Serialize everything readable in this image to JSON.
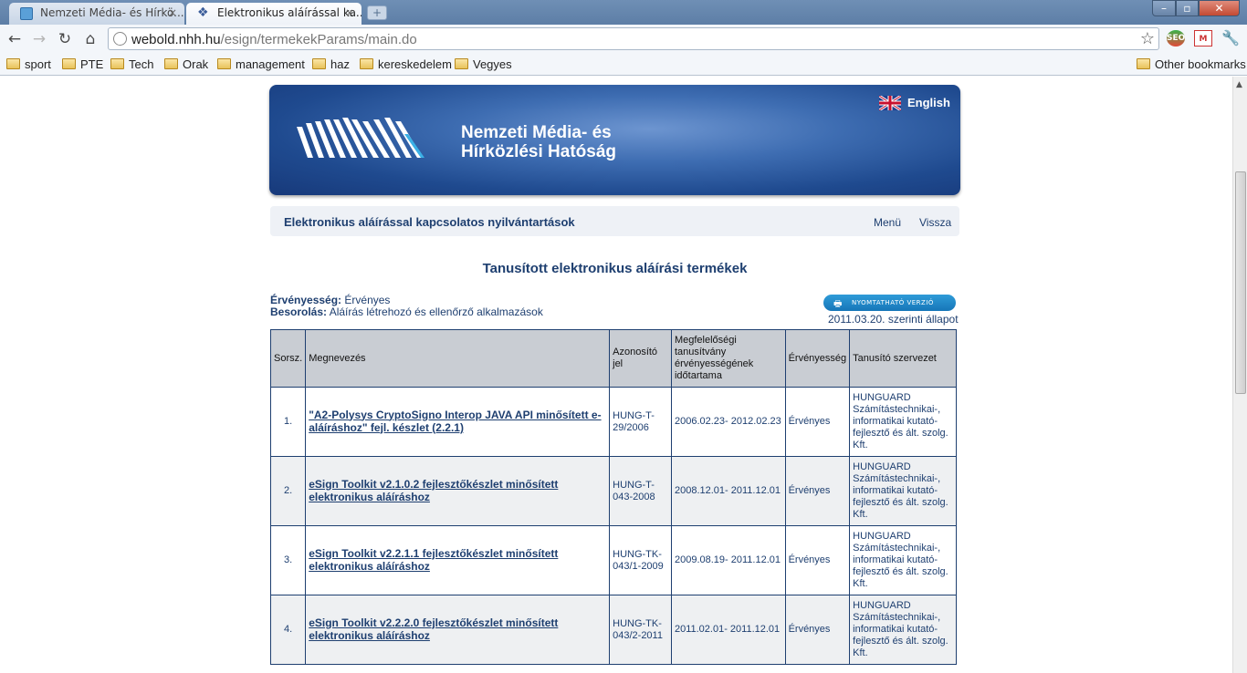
{
  "browser": {
    "tabs": [
      {
        "title": "Nemzeti Média- és Hírkö...",
        "active": false
      },
      {
        "title": "Elektronikus aláírással ka...",
        "active": true
      }
    ],
    "url_domain": "webold.nhh.hu",
    "url_path": "/esign/termekekParams/main.do",
    "bookmarks": [
      "sport",
      "PTE",
      "Tech",
      "Orak",
      "management",
      "haz",
      "kereskedelem",
      "Vegyes"
    ],
    "other_bookmarks": "Other bookmarks",
    "extensions": {
      "seo": "SEO"
    }
  },
  "banner": {
    "org_line1": "Nemzeti Média- és",
    "org_line2": "Hírközlési Hatóság",
    "language_link": "English"
  },
  "subnav": {
    "title": "Elektronikus aláírással kapcsolatos nyilvántartások",
    "menu": "Menü",
    "back": "Vissza"
  },
  "heading": "Tanusított elektronikus aláírási termékek",
  "filters": {
    "validity_label": "Érvényesség:",
    "validity_value": "Érvényes",
    "category_label": "Besorolás:",
    "category_value": "Aláírás létrehozó és ellenőrző alkalmazások"
  },
  "print_button": "NYOMTATHATÓ VERZIÓ",
  "as_of": "2011.03.20. szerinti állapot",
  "table": {
    "headers": [
      "Sorsz.",
      "Megnevezés",
      "Azonosító jel",
      "Megfelelőségi tanusítvány érvényességének időtartama",
      "Érvényesség",
      "Tanusító szervezet"
    ],
    "rows": [
      {
        "num": "1.",
        "name": "\"A2-Polysys CryptoSigno Interop JAVA API minősített e-aláíráshoz\" fejl. készlet (2.2.1)",
        "id": "HUNG-T-29/2006",
        "period": "2006.02.23- 2012.02.23",
        "validity": "Érvényes",
        "org": "HUNGUARD Számítástechnikai-, informatikai kutató-fejlesztő és ált. szolg. Kft."
      },
      {
        "num": "2.",
        "name": "eSign Toolkit v2.1.0.2 fejlesztőkészlet minősített elektronikus aláíráshoz",
        "id": "HUNG-T-043-2008",
        "period": "2008.12.01- 2011.12.01",
        "validity": "Érvényes",
        "org": "HUNGUARD Számítástechnikai-, informatikai kutató-fejlesztő és ált. szolg. Kft."
      },
      {
        "num": "3.",
        "name": "eSign Toolkit v2.2.1.1 fejlesztőkészlet minősített elektronikus aláíráshoz",
        "id": "HUNG-TK-043/1-2009",
        "period": "2009.08.19- 2011.12.01",
        "validity": "Érvényes",
        "org": "HUNGUARD Számítástechnikai-, informatikai kutató-fejlesztő és ált. szolg. Kft."
      },
      {
        "num": "4.",
        "name": "eSign Toolkit v2.2.2.0 fejlesztőkészlet minősített elektronikus aláíráshoz",
        "id": "HUNG-TK-043/2-2011",
        "period": "2011.02.01- 2011.12.01",
        "validity": "Érvényes",
        "org": "HUNGUARD Számítástechnikai-, informatikai kutató-fejlesztő és ált. szolg. Kft."
      }
    ]
  }
}
